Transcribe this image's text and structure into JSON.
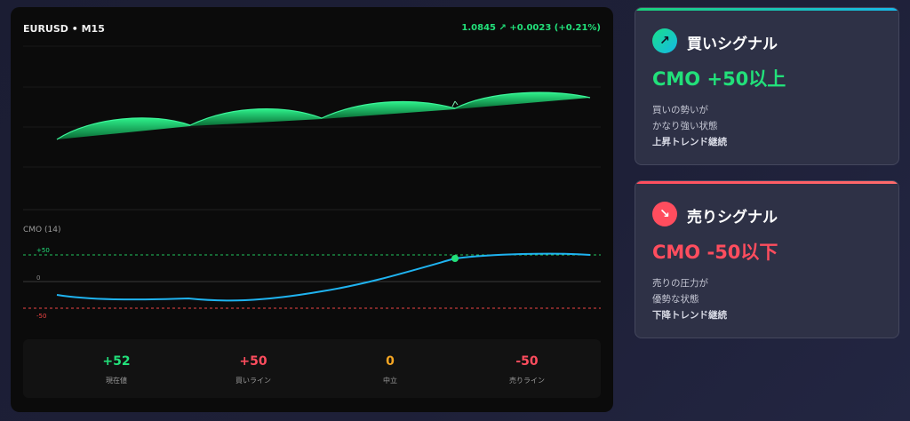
{
  "chart": {
    "symbol": "EURUSD • M15",
    "quote": "1.0845 ↗ +0.0023 (+0.21%)",
    "indicator_label": "CMO (14)",
    "level_buy": "+50",
    "level_zero": "0",
    "level_sell": "-50"
  },
  "stats": [
    {
      "value": "+52",
      "label": "現在値",
      "color": "#22e07a"
    },
    {
      "value": "+50",
      "label": "買いライン",
      "color": "#ff4d5e"
    },
    {
      "value": "0",
      "label": "中立",
      "color": "#f5a623"
    },
    {
      "value": "-50",
      "label": "売りライン",
      "color": "#ff4d5e"
    }
  ],
  "buy_card": {
    "icon": "trend-up-icon",
    "icon_glyph": "↗",
    "title": "買いシグナル",
    "condition": "CMO +50以上",
    "desc1": "買いの勢いが",
    "desc2": "かなり強い状態",
    "desc3": "上昇トレンド継続",
    "accent": "#22e07a"
  },
  "sell_card": {
    "icon": "trend-down-icon",
    "icon_glyph": "↘",
    "title": "売りシグナル",
    "condition": "CMO -50以下",
    "desc1": "売りの圧力が",
    "desc2": "優勢な状態",
    "desc3": "下降トレンド継続",
    "accent": "#ff4d5e"
  },
  "colors": {
    "price_up": "#22e07a",
    "cmo_line": "#1fb3f0",
    "buy_level": "#22c55e",
    "sell_level": "#ef4444",
    "signal_dot": "#22e07a"
  }
}
